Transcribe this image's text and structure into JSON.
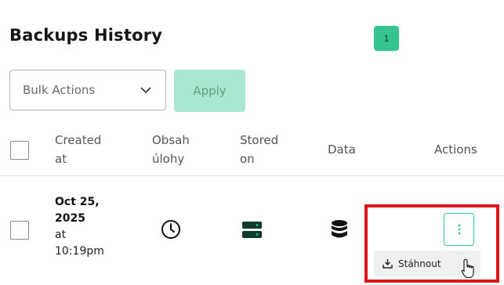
{
  "page": {
    "title": "Backups History",
    "count_badge": "1"
  },
  "toolbar": {
    "bulk_actions_label": "Bulk Actions",
    "apply_label": "Apply"
  },
  "table": {
    "headers": {
      "created": [
        "Created",
        "at"
      ],
      "obsah": [
        "Obsah",
        "úlohy"
      ],
      "stored": [
        "Stored",
        "on"
      ],
      "data": "Data",
      "actions": "Actions"
    },
    "rows": [
      {
        "date_line1": "Oct 25,",
        "date_line2": "2025",
        "at": "at",
        "time": "10:19pm",
        "task_icon": "clock-icon",
        "stored_icon": "server-icon",
        "data_icon": "database-icon",
        "actions_icon": "vertical-dots-icon"
      }
    ]
  },
  "action_menu": {
    "items": [
      {
        "label": "Stáhnout",
        "icon": "download-icon"
      }
    ]
  },
  "colors": {
    "accent": "#35c490",
    "accent_light": "#a9e6cf",
    "highlight": "#e0141d",
    "icon_dark": "#0e3a2a"
  }
}
